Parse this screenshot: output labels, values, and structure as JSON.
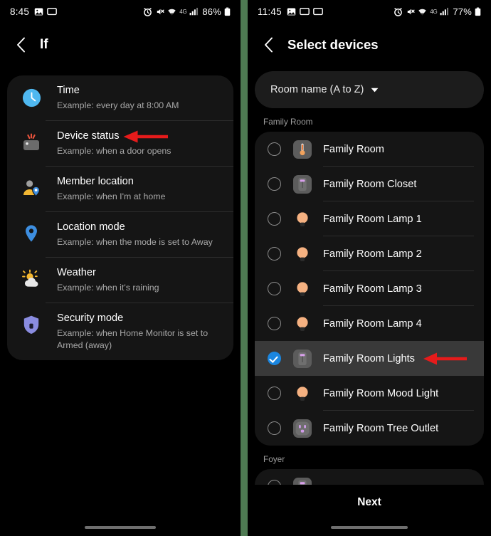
{
  "left_screen": {
    "status_bar": {
      "time": "8:45",
      "battery_percent": "86%",
      "left_icons": [
        "screenshot-icon",
        "cast-icon"
      ],
      "right_icons": [
        "alarm-icon",
        "mute-icon",
        "wifi-icon",
        "4g-icon",
        "signal-icon",
        "battery-icon"
      ],
      "network_label": "4G"
    },
    "app_bar": {
      "back": "back-chevron",
      "title": "If"
    },
    "options": [
      {
        "icon": "clock-icon",
        "title": "Time",
        "subtitle": "Example: every day at 8:00 AM"
      },
      {
        "icon": "device-sensor-icon",
        "title": "Device status",
        "subtitle": "Example: when a door opens",
        "annotated": true
      },
      {
        "icon": "member-location-icon",
        "title": "Member location",
        "subtitle": "Example: when I'm at home"
      },
      {
        "icon": "location-pin-icon",
        "title": "Location mode",
        "subtitle": "Example: when the mode is set to Away"
      },
      {
        "icon": "weather-icon",
        "title": "Weather",
        "subtitle": "Example: when it's raining"
      },
      {
        "icon": "shield-icon",
        "title": "Security mode",
        "subtitle": "Example: when Home Monitor is set to Armed (away)"
      }
    ]
  },
  "right_screen": {
    "status_bar": {
      "time": "11:45",
      "battery_percent": "77%",
      "left_icons": [
        "screenshot-icon",
        "cast-icon",
        "cast-icon"
      ],
      "right_icons": [
        "alarm-icon",
        "mute-icon",
        "wifi-icon",
        "4g-icon",
        "signal-icon",
        "battery-icon"
      ],
      "network_label": "4G"
    },
    "app_bar": {
      "back": "back-chevron",
      "title": "Select devices"
    },
    "sort": {
      "label": "Room name (A to Z)",
      "caret": "chevron-down-icon"
    },
    "groups": [
      {
        "name": "Family Room",
        "devices": [
          {
            "name": "Family Room",
            "icon": "thermometer-icon",
            "selected": false
          },
          {
            "name": "Family Room Closet",
            "icon": "light-switch-icon",
            "selected": false
          },
          {
            "name": "Family Room Lamp 1",
            "icon": "bulb-icon",
            "selected": false
          },
          {
            "name": "Family Room Lamp 2",
            "icon": "bulb-icon",
            "selected": false
          },
          {
            "name": "Family Room Lamp 3",
            "icon": "bulb-icon",
            "selected": false
          },
          {
            "name": "Family Room Lamp 4",
            "icon": "bulb-icon",
            "selected": false
          },
          {
            "name": "Family Room Lights",
            "icon": "light-switch-icon",
            "selected": true,
            "annotated": true
          },
          {
            "name": "Family Room Mood Light",
            "icon": "bulb-icon",
            "selected": false
          },
          {
            "name": "Family Room Tree Outlet",
            "icon": "outlet-icon",
            "selected": false
          }
        ]
      },
      {
        "name": "Foyer",
        "devices": []
      }
    ],
    "bottom": {
      "next_label": "Next"
    }
  },
  "colors": {
    "accent_blue": "#1a86e0",
    "annotation_red": "#e61b1b",
    "divider_green": "#4e7a52",
    "card_bg": "#151515",
    "selected_row": "#393939"
  }
}
